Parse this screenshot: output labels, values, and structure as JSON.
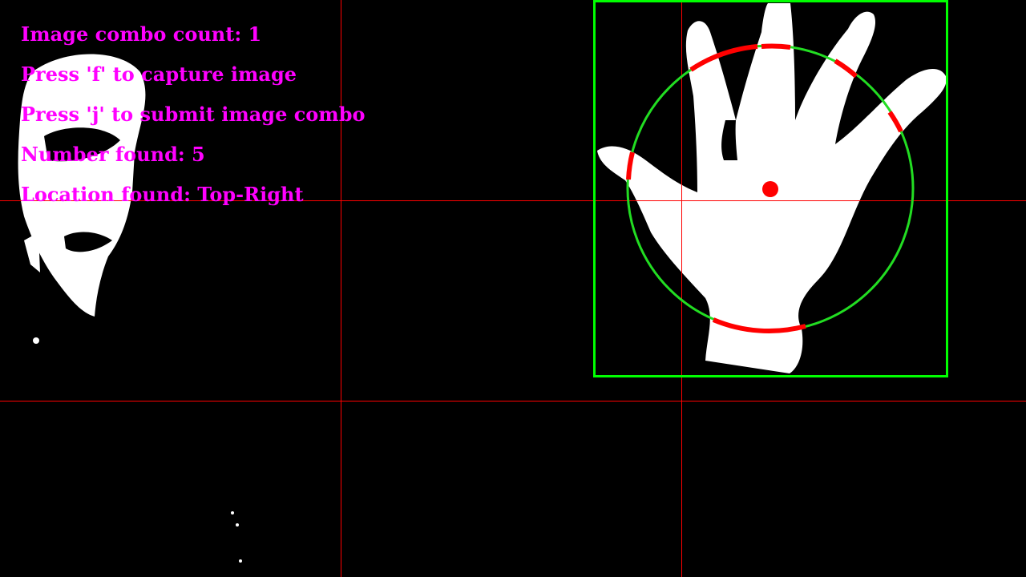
{
  "hud": {
    "combo_count": "Image combo count: 1",
    "capture_hint": "Press 'f' to capture image",
    "submit_hint": "Press 'j' to submit image combo",
    "number_found": "Number found: 5",
    "location_found": "Location found: Top-Right"
  },
  "detection": {
    "fingers_detected": 5,
    "location": "Top-Right"
  },
  "colors": {
    "background": "#000000",
    "foreground_mask": "#ffffff",
    "hud_text": "#ff00ff",
    "grid_lines": "#ff0000",
    "bounding_box": "#00ff00",
    "sample_circle": "#22dd22",
    "finger_arcs": "#ff0000",
    "palm_center": "#ff0000"
  },
  "icons": {
    "hand": "hand-silhouette",
    "face": "face-silhouette"
  }
}
